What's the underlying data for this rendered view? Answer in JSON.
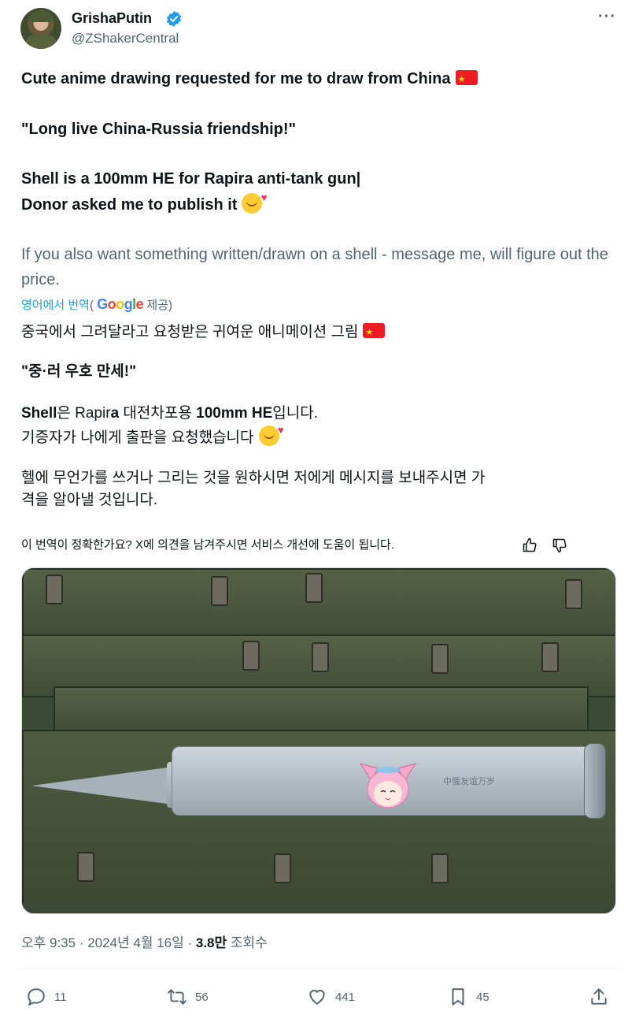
{
  "author": {
    "display_name": "GrishaPutin",
    "handle": "@ZShakerCentral",
    "verified_icon": "verified-badge-icon"
  },
  "tweet": {
    "line1": "Cute anime drawing requested for me to draw from China",
    "line2": "\"Long live China-Russia friendship!\"",
    "line3": "Shell is a 100mm HE for Rapira anti-tank gun|",
    "line4": "Donor asked me to publish it",
    "line5": "If you also want something written/drawn on a shell - message me, will figure out the price."
  },
  "translation": {
    "link_label": "영어에서 번역",
    "provider_prefix": "(",
    "provider_suffix": "제공)",
    "line1": "중국에서 그려달라고 요청받은 귀여운 애니메이션 그림",
    "line2": "\"중·러 우호 만세!\"",
    "line3_a": "Shell",
    "line3_b": "은 ",
    "line3_c": "Rapir",
    "line3_d": "a",
    "line3_e": " 대전차포용 ",
    "line3_f": "100mm HE",
    "line3_g": "입니다.",
    "line4": "기증자가 나에게 출판을 요청했습니다",
    "line5": "헬에 무언가를 쓰거나 그리는 것을 원하시면 저에게 메시지를 보내주시면 가",
    "line6": "격을 알아낼 것입니다."
  },
  "feedback": {
    "question": "이 번역이 정확한가요? X에 의견을 남겨주시면 서비스 개선에 도움이 됩니다."
  },
  "image": {
    "shell_text": "中俄友谊万岁"
  },
  "meta": {
    "time": "오후 9:35",
    "sep1": " · ",
    "date": "2024년 4월 16일",
    "sep2": " · ",
    "views": "3.8만",
    "views_label": " 조회수"
  },
  "actions": {
    "replies": "11",
    "reposts": "56",
    "likes": "441",
    "bookmarks": "45"
  },
  "colors": {
    "accent": "#1d9bf0",
    "secondary_text": "#536471"
  }
}
